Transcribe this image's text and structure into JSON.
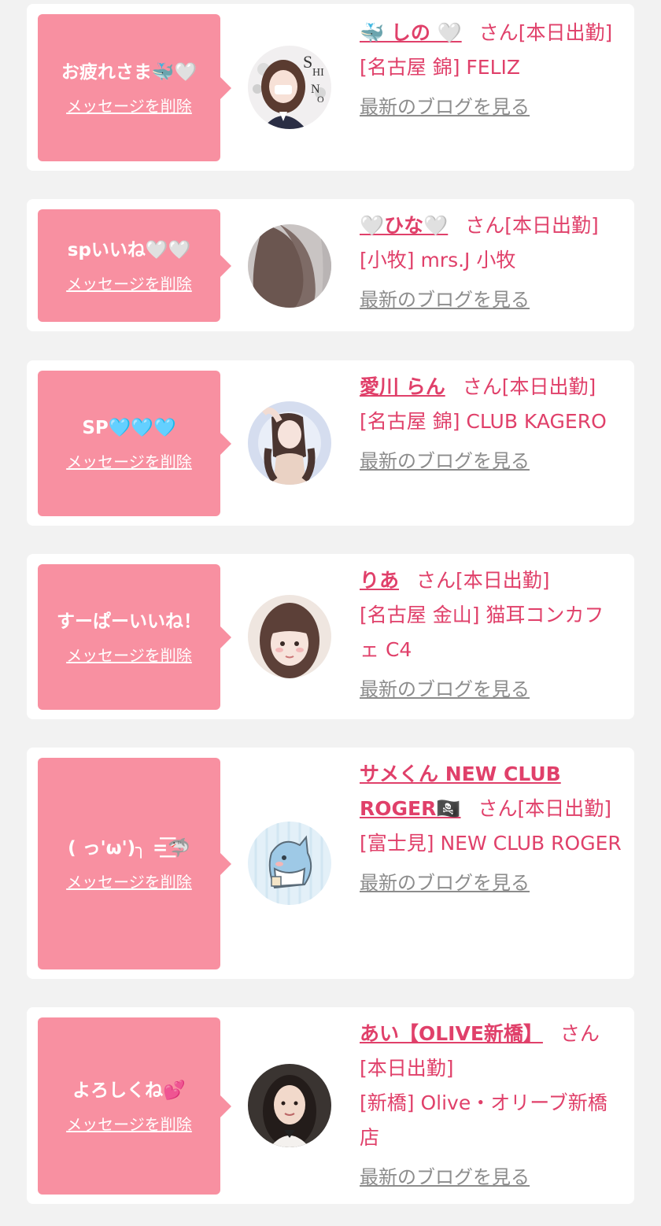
{
  "labels": {
    "delete": "メッセージを削除",
    "blog": "最新のブログを見る",
    "san": "さん"
  },
  "colors": {
    "page_bg": "#f2f2f2",
    "card_bg": "#ffffff",
    "bubble_pink": "#f890a1",
    "name_pink": "#e0406a",
    "link_gray": "#8c8c8c"
  },
  "entries": [
    {
      "message": "お疲れさま🐳🤍",
      "name": "🐳 しの 🤍",
      "status": "[本日出勤]",
      "shop": "[名古屋 錦] FELIZ",
      "avatar": "avatar-girl-with-shino-logo"
    },
    {
      "message": "spいいね🤍🤍",
      "name": "🤍ひな🤍",
      "status": "[本日出勤]",
      "shop": "[小牧] mrs.J 小牧",
      "avatar": "avatar-long-hair-back"
    },
    {
      "message": "SP🩵🩵🩵",
      "name": "愛川 らん",
      "status": "[本日出勤]",
      "shop": "[名古屋 錦] CLUB KAGERO",
      "avatar": "avatar-girl-pose"
    },
    {
      "message": "すーぱーいいね！",
      "name": "りあ",
      "status": "[本日出勤]",
      "shop": "[名古屋 金山] 猫耳コンカフェ C4",
      "avatar": "avatar-girl-bangs"
    },
    {
      "message": "( っ'ω')╮ =͟͟͞͞🦈",
      "name": "サメくん NEW CLUB ROGER🏴‍☠️",
      "status": "[本日出勤]",
      "shop": "[富士見] NEW CLUB ROGER",
      "avatar": "avatar-shark-cartoon"
    },
    {
      "message": "よろしくね💕",
      "name": "あい【OLIVE新橋】",
      "status": "[本日出勤]",
      "shop": "[新橋] Olive・オリーブ新橋店",
      "avatar": "avatar-girl-dark-hair"
    }
  ]
}
